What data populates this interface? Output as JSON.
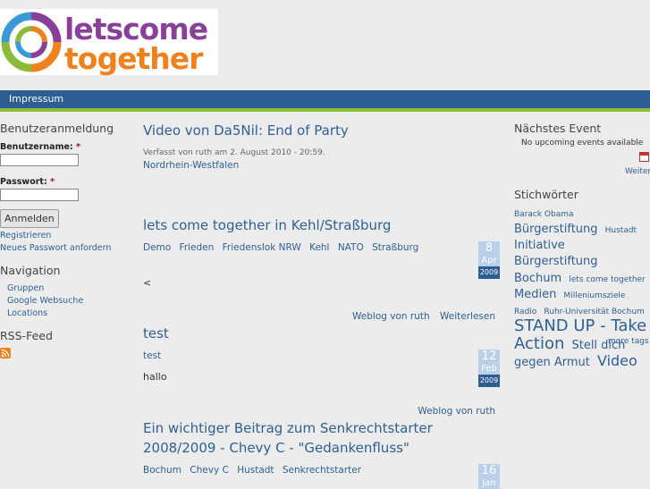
{
  "site": {
    "logo_line1": "letscome",
    "logo_line2": "together"
  },
  "navbar": {
    "impressum": "Impressum"
  },
  "login": {
    "title": "Benutzeranmeldung",
    "username_label": "Benutzername:",
    "password_label": "Passwort:",
    "required_mark": "*",
    "submit": "Anmelden",
    "register": "Registrieren",
    "new_password": "Neues Passwort anfordern"
  },
  "navigation": {
    "title": "Navigation",
    "items": [
      "Gruppen",
      "Google Websuche",
      "Locations"
    ]
  },
  "rss": {
    "title": "RSS-Feed"
  },
  "posts": [
    {
      "title": "Video von Da5Nil: End of Party",
      "meta": "Verfasst von ruth am 2. August 2010 - 20:59.",
      "terms": [
        "Nordrhein-Westfalen"
      ]
    },
    {
      "title": "lets come together in Kehl/Straßburg",
      "terms": [
        "Demo",
        "Frieden",
        "Friedenslok NRW",
        "Kehl",
        "NATO",
        "Straßburg"
      ],
      "body": "<",
      "date": {
        "day": "8",
        "month": "Apr",
        "year": "2009"
      },
      "links": [
        "Weblog von ruth",
        "Weiterlesen"
      ]
    },
    {
      "title": "test",
      "terms": [
        "test"
      ],
      "body": "hallo",
      "date": {
        "day": "12",
        "month": "Feb",
        "year": "2009"
      },
      "links": [
        "Weblog von ruth"
      ]
    },
    {
      "title_line1": "Ein wichtiger Beitrag zum Senkrechtstarter",
      "title_line2": "2008/2009 - Chevy C - \"Gedankenfluss\"",
      "terms": [
        "Bochum",
        "Chevy C",
        "Hustadt",
        "Senkrechtstarter"
      ],
      "date": {
        "day": "16",
        "month": "Jan"
      }
    }
  ],
  "events": {
    "title": "Nächstes Event",
    "empty": "No upcoming events available",
    "more": "Weiter"
  },
  "tags": {
    "title": "Stichwörter",
    "items": [
      {
        "label": "Barack Obama",
        "size": 1
      },
      {
        "label": "Bürgerstiftung",
        "size": 3
      },
      {
        "label": "Hustadt",
        "size": 1
      },
      {
        "label": "Initiative Bürgerstiftung",
        "size": 3
      },
      {
        "label": "Bochum",
        "size": 3
      },
      {
        "label": "lets come together",
        "size": 1
      },
      {
        "label": "Medien",
        "size": 3
      },
      {
        "label": "Milleniumsziele",
        "size": 1
      },
      {
        "label": "Radio",
        "size": 1
      },
      {
        "label": "Ruhr-Universität Bochum",
        "size": 1
      },
      {
        "label": "STAND UP - Take Action",
        "size": 5
      },
      {
        "label": "Stell dich gegen Armut",
        "size": 3
      },
      {
        "label": "Video",
        "size": 4
      }
    ],
    "more": "more tags"
  }
}
